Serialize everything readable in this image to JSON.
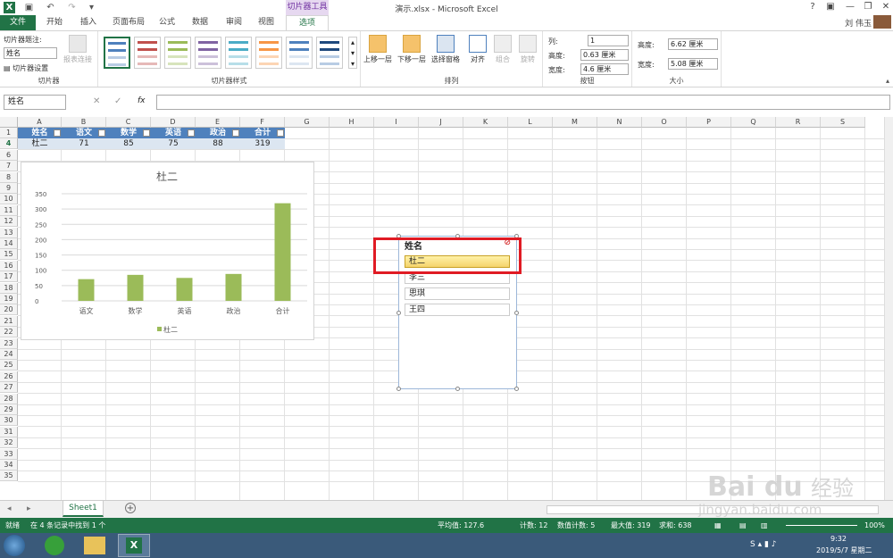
{
  "window": {
    "title": "演示.xlsx - Microsoft Excel",
    "contextual_tab": "切片器工具",
    "user": "刘 伟玉"
  },
  "tabs": [
    "文件",
    "开始",
    "插入",
    "页面布局",
    "公式",
    "数据",
    "审阅",
    "视图",
    "选项"
  ],
  "active_tab": "选项",
  "ribbon": {
    "slicer_group": {
      "caption_label": "切片器题注:",
      "caption_value": "姓名",
      "settings_label": "切片器设置",
      "report_connections": "报表连接",
      "label": "切片器"
    },
    "styles_group": {
      "label": "切片器样式"
    },
    "arrange_group": {
      "label": "排列",
      "bring_forward": "上移一层",
      "send_backward": "下移一层",
      "selection_pane": "选择窗格",
      "align": "对齐",
      "group": "组合",
      "rotate": "旋转"
    },
    "buttons_group": {
      "label": "按钮",
      "columns_label": "列:",
      "columns_value": "1",
      "height_label": "高度:",
      "height_value": "0.63 厘米",
      "width_label": "宽度:",
      "width_value": "4.6 厘米"
    },
    "size_group": {
      "label": "大小",
      "height_label": "高度:",
      "height_value": "6.62 厘米",
      "width_label": "宽度:",
      "width_value": "5.08 厘米"
    }
  },
  "formula_bar": {
    "name_box": "姓名",
    "fx": "fx",
    "content": ""
  },
  "columns": [
    "A",
    "B",
    "C",
    "D",
    "E",
    "F",
    "G",
    "H",
    "I",
    "J",
    "K",
    "L",
    "M",
    "N",
    "O",
    "P",
    "Q",
    "R",
    "S"
  ],
  "rows": [
    "1",
    "4",
    "6",
    "7",
    "8",
    "9",
    "10",
    "11",
    "12",
    "13",
    "14",
    "15",
    "16",
    "17",
    "18",
    "19",
    "20",
    "21",
    "22",
    "23",
    "24",
    "25",
    "26",
    "27",
    "28",
    "29",
    "30",
    "31",
    "32",
    "33",
    "34",
    "35"
  ],
  "table": {
    "headers": [
      "姓名",
      "语文",
      "数学",
      "英语",
      "政治",
      "合计"
    ],
    "row": [
      "杜二",
      "71",
      "85",
      "75",
      "88",
      "319"
    ]
  },
  "chart_data": {
    "type": "bar",
    "title": "杜二",
    "categories": [
      "语文",
      "数学",
      "英语",
      "政治",
      "合计"
    ],
    "series": [
      {
        "name": "杜二",
        "values": [
          71,
          85,
          75,
          88,
          319
        ]
      }
    ],
    "ylim": [
      0,
      350
    ],
    "yticks": [
      0,
      50,
      100,
      150,
      200,
      250,
      300,
      350
    ],
    "bar_color": "#9bbb59",
    "grid": true,
    "legend": "bottom"
  },
  "slicer": {
    "title": "姓名",
    "items": [
      "杜二",
      "李三",
      "思琪",
      "王四"
    ],
    "selected": "杜二"
  },
  "sheet_tab": "Sheet1",
  "status": {
    "ready": "就绪",
    "found": "在 4 条记录中找到 1 个",
    "average": "平均值: 127.6",
    "count": "计数: 12",
    "num_count": "数值计数: 5",
    "max": "最大值: 319",
    "sum": "求和: 638",
    "zoom": "100%"
  },
  "taskbar": {
    "time": "9:32",
    "date": "2019/5/7 星期二"
  },
  "watermark": "Baidu 经验 jingyan.baidu.com"
}
